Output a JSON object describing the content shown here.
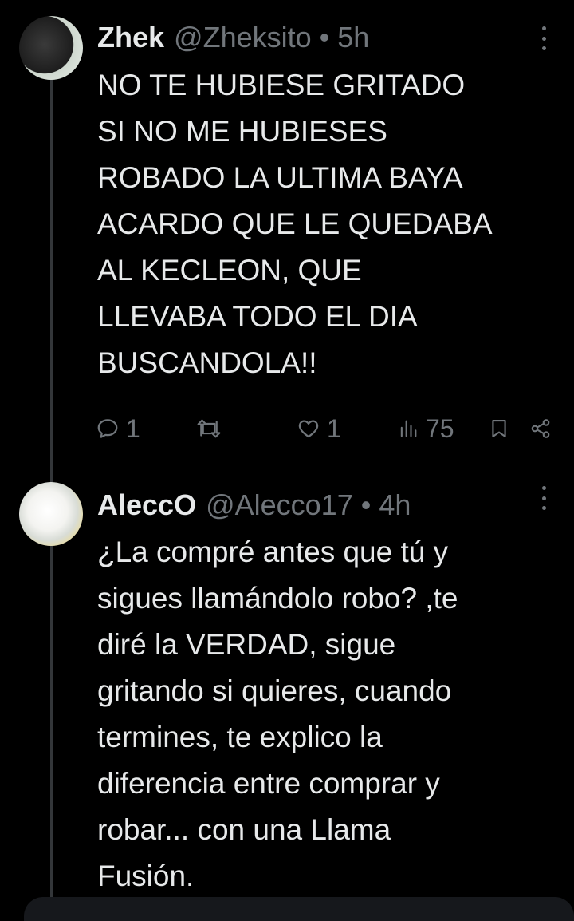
{
  "tweets": [
    {
      "display_name": "Zhek",
      "handle": "@Zheksito",
      "separator": "•",
      "time": "5h",
      "text": "NO TE HUBIESE GRITADO\nSI NO ME HUBIESES\nROBADO LA ULTIMA BAYA\nACARDO QUE LE QUEDABA\nAL KECLEON, QUE\nLLEVABA TODO EL DIA\nBUSCANDOLA!!",
      "stats": {
        "replies": "1",
        "likes": "1",
        "views": "75"
      }
    },
    {
      "display_name": "AleccO",
      "handle": "@Alecco17",
      "separator": "•",
      "time": "4h",
      "text": "¿La compré antes que tú y\nsigues llamándolo robo? ,te\ndiré la VERDAD, sigue\ngritando si quieres, cuando\ntermines, te explico la\ndiferencia entre comprar y\nrobar... con una Llama\nFusión."
    }
  ],
  "icons": {
    "reply": "reply-icon",
    "retweet": "retweet-icon",
    "like": "heart-icon",
    "views": "views-chart-icon",
    "bookmark": "bookmark-icon",
    "share": "share-icon",
    "more": "more-vertical-icon"
  },
  "colors": {
    "background": "#000000",
    "text": "#e7e9ea",
    "muted": "#71767b",
    "thread_line": "#333639"
  }
}
